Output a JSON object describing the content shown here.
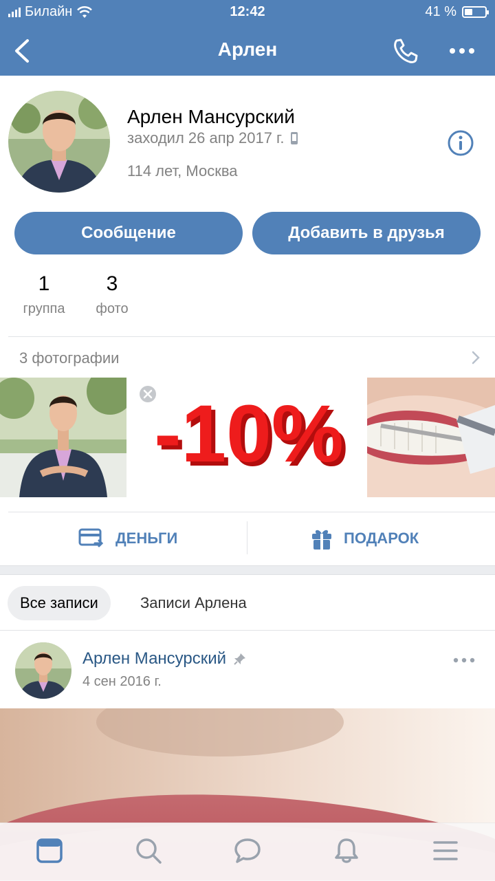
{
  "status_bar": {
    "carrier": "Билайн",
    "time": "12:42",
    "battery_text": "41 %",
    "battery_level": 0.41
  },
  "nav": {
    "title": "Арлен"
  },
  "profile": {
    "name": "Арлен Мансурский",
    "last_seen": "заходил 26 апр 2017 г.",
    "age_city": "114 лет, Москва"
  },
  "buttons": {
    "message": "Сообщение",
    "add_friend": "Добавить в друзья"
  },
  "counters": [
    {
      "value": "1",
      "label": "группа"
    },
    {
      "value": "3",
      "label": "фото"
    }
  ],
  "photos": {
    "title": "3 фотографии",
    "discount_text": "-10%"
  },
  "actions": {
    "money": "ДЕНЬГИ",
    "gift": "ПОДАРОК"
  },
  "wall_tabs": {
    "all": "Все записи",
    "own": "Записи Арлена"
  },
  "post": {
    "author": "Арлен Мансурский",
    "date": "4 сен 2016 г."
  },
  "colors": {
    "accent": "#5181b8",
    "secondary_text": "#828282",
    "link": "#2a5885"
  },
  "icons": [
    "back-icon",
    "phone-icon",
    "more-icon",
    "info-icon",
    "mobile-icon",
    "money-icon",
    "gift-icon",
    "pin-icon",
    "news-icon",
    "search-icon",
    "messages-icon",
    "notifications-icon",
    "menu-icon"
  ]
}
